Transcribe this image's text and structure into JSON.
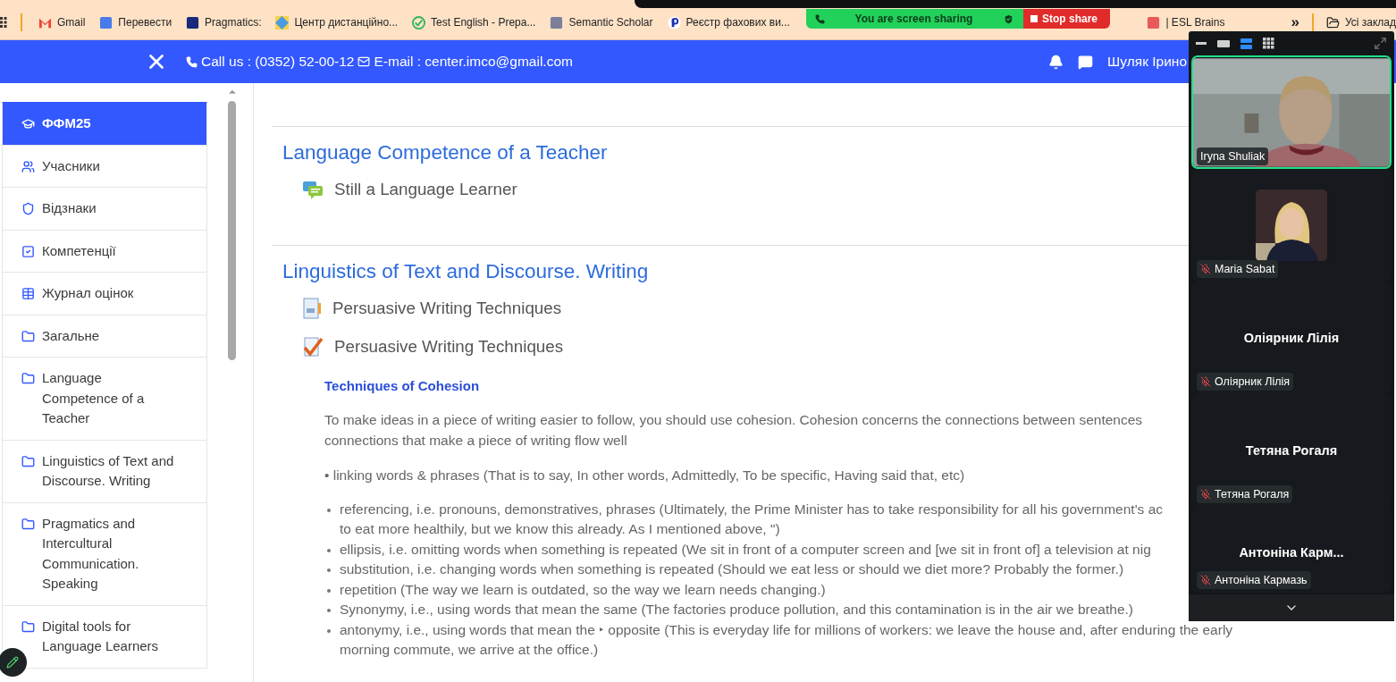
{
  "bookmarks": [
    {
      "label": "Gmail",
      "kind": "gmail"
    },
    {
      "label": "Перевести",
      "kind": "translate"
    },
    {
      "label": "Pragmatics:",
      "kind": "r"
    },
    {
      "label": "Центр дистанційно...",
      "kind": "grid"
    },
    {
      "label": "Test English - Prepa...",
      "kind": "check"
    },
    {
      "label": "Semantic Scholar",
      "kind": "scholar"
    },
    {
      "label": "Реєстр фахових ви...",
      "kind": "p"
    },
    {
      "label": "| ESL Brains",
      "kind": "bulb"
    }
  ],
  "bookmarks_more": "»",
  "other_bookmarks": "Усі заклад",
  "share_banner": {
    "status": "You are screen sharing",
    "stop_button": "Stop share"
  },
  "site_header": {
    "phone": "Call us : (0352) 52-00-12",
    "email": "E-mail : center.imco@gmail.com",
    "user": "Шуляк Ірино"
  },
  "sidebar": {
    "items": [
      {
        "label": "ФФМ25",
        "selected": true
      },
      {
        "label": "Учасники",
        "selected": false
      },
      {
        "label": "Відзнаки",
        "selected": false
      },
      {
        "label": "Компетенції",
        "selected": false
      },
      {
        "label": "Журнал оцінок",
        "selected": false
      },
      {
        "label": "Загальне",
        "selected": false
      },
      {
        "label": "Language\nCompetence of a\nTeacher",
        "selected": false
      },
      {
        "label": "Linguistics of Text and\nDiscourse. Writing",
        "selected": false
      },
      {
        "label": "Pragmatics and\nIntercultural\nCommunication.\nSpeaking",
        "selected": false
      },
      {
        "label": "Digital tools for\nLanguage Learners",
        "selected": false
      }
    ]
  },
  "sections": [
    {
      "title": "Language Competence of a Teacher",
      "activities": [
        {
          "label": "Still a Language Learner",
          "kind": "forum"
        }
      ]
    },
    {
      "title": "Linguistics of Text and Discourse. Writing",
      "activities": [
        {
          "label": "Persuasive Writing Techniques",
          "kind": "page"
        },
        {
          "label": "Persuasive Writing Techniques",
          "kind": "quiz"
        }
      ],
      "description": {
        "heading": "Techniques of Cohesion",
        "paragraph_lines": [
          "To make ideas in a piece of writing easier to follow, you should use cohesion. Cohesion concerns the connections between sentences",
          "connections that make a piece of writing flow well"
        ],
        "inline_bullet": "• linking words & phrases (That is to say, In other words, Admittedly, To be specific, Having said that, etc)",
        "bullets": [
          {
            "lines": [
              "referencing, i.e. pronouns, demonstratives, phrases (Ultimately, the Prime Minister has to take responsibility for all his government's ac",
              "to eat more healthily, but we know this already. As I mentioned above, \")"
            ]
          },
          {
            "lines": [
              "ellipsis, i.e. omitting words when something is repeated (We sit in front of a computer screen and [we sit in front of] a television at nig"
            ]
          },
          {
            "lines": [
              "substitution, i.e. changing words when something is repeated (Should we eat less or should we diet more? Probably the former.)"
            ]
          },
          {
            "lines": [
              "repetition (The way we learn is outdated, so the way we learn needs changing.)"
            ]
          },
          {
            "lines": [
              "Synonymy, i.e., using words that mean the same (The factories produce pollution, and this contamination is in the air we breathe.)"
            ]
          },
          {
            "lines": [
              "antonymy, i.e., using words that mean the ‣ opposite (This is everyday life for millions of workers: we leave the house and, after enduring the early",
              "morning commute, we arrive at the office.)"
            ]
          }
        ]
      }
    }
  ],
  "zoom_panel": {
    "view_modes": [
      {
        "kind": "minimize",
        "selected": false
      },
      {
        "kind": "single",
        "selected": false
      },
      {
        "kind": "strip",
        "selected": true
      },
      {
        "kind": "grid",
        "selected": false
      }
    ],
    "participants": [
      {
        "name": "Iryna Shuliak",
        "kind": "video",
        "speaking": true,
        "muted": false
      },
      {
        "name": "Maria Sabat",
        "speaking": false,
        "muted": true
      },
      {
        "name": "Оліярник Лілія",
        "kind": "name",
        "heading": "Оліярник Лілія",
        "speaking": false,
        "muted": true
      },
      {
        "name": "Тетяна Рогаля",
        "kind": "name",
        "heading": "Тетяна Рогаля",
        "speaking": false,
        "muted": true
      },
      {
        "name": "Антоніна Кармазь",
        "kind": "name",
        "heading": "Антоніна Карм...",
        "speaking": false,
        "muted": true
      }
    ]
  }
}
